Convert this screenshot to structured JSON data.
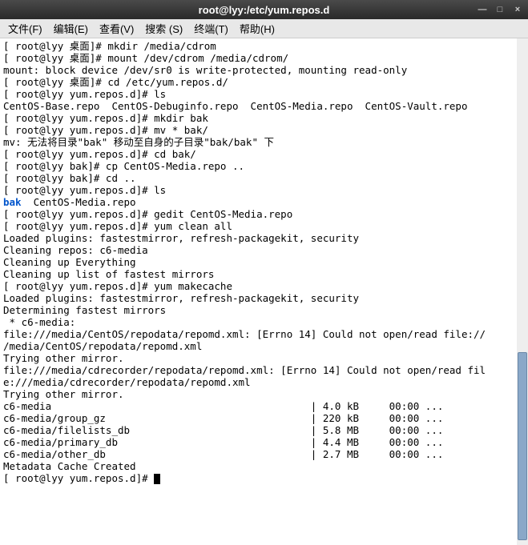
{
  "titlebar": {
    "title": "root@lyy:/etc/yum.repos.d"
  },
  "menu": {
    "file": "文件(F)",
    "edit": "编辑(E)",
    "view": "查看(V)",
    "search": "搜索 (S)",
    "terminal": "终端(T)",
    "help": "帮助(H)"
  },
  "l": {
    "01": "[ root@lyy 桌面]# mkdir /media/cdrom",
    "02": "[ root@lyy 桌面]# mount /dev/cdrom /media/cdrom/",
    "03": "mount: block device /dev/sr0 is write-protected, mounting read-only",
    "04": "[ root@lyy 桌面]# cd /etc/yum.repos.d/",
    "05": "[ root@lyy yum.repos.d]# ls",
    "06": "CentOS-Base.repo  CentOS-Debuginfo.repo  CentOS-Media.repo  CentOS-Vault.repo",
    "07": "[ root@lyy yum.repos.d]# mkdir bak",
    "08": "[ root@lyy yum.repos.d]# mv * bak/",
    "09": "mv: 无法将目录\"bak\" 移动至自身的子目录\"bak/bak\" 下",
    "10": "[ root@lyy yum.repos.d]# cd bak/",
    "11": "[ root@lyy bak]# cp CentOS-Media.repo ..",
    "12": "[ root@lyy bak]# cd ..",
    "13": "[ root@lyy yum.repos.d]# ls",
    "14a": "bak",
    "14b": "  CentOS-Media.repo",
    "15": "[ root@lyy yum.repos.d]# gedit CentOS-Media.repo",
    "16": "[ root@lyy yum.repos.d]# yum clean all",
    "17": "Loaded plugins: fastestmirror, refresh-packagekit, security",
    "18": "Cleaning repos: c6-media",
    "19": "Cleaning up Everything",
    "20": "Cleaning up list of fastest mirrors",
    "21": "[ root@lyy yum.repos.d]# yum makecache",
    "22": "Loaded plugins: fastestmirror, refresh-packagekit, security",
    "23": "Determining fastest mirrors",
    "24": " * c6-media:",
    "25": "file:///media/CentOS/repodata/repomd.xml: [Errno 14] Could not open/read file://",
    "26": "/media/CentOS/repodata/repomd.xml",
    "27": "Trying other mirror.",
    "28": "file:///media/cdrecorder/repodata/repomd.xml: [Errno 14] Could not open/read fil",
    "29": "e:///media/cdrecorder/repodata/repomd.xml",
    "30": "Trying other mirror.",
    "31": "c6-media                                           | 4.0 kB     00:00 ...",
    "32": "c6-media/group_gz                                  | 220 kB     00:00 ...",
    "33": "c6-media/filelists_db                              | 5.8 MB     00:00 ...",
    "34": "c6-media/primary_db                                | 4.4 MB     00:00 ...",
    "35": "c6-media/other_db                                  | 2.7 MB     00:00 ...",
    "36": "Metadata Cache Created",
    "37": "[ root@lyy yum.repos.d]# "
  }
}
